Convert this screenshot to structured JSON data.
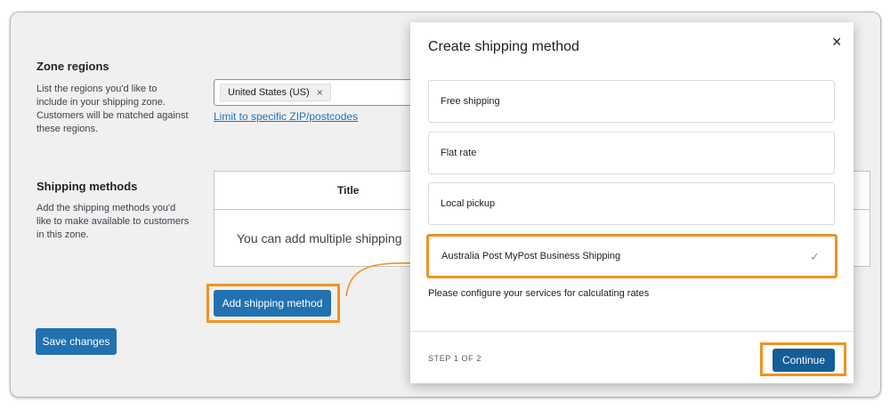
{
  "zone_regions": {
    "title": "Zone regions",
    "description": [
      "List the regions you'd like to",
      "include in your shipping zone.",
      "Customers will be matched against",
      "these regions."
    ],
    "selected_region": "United States (US)",
    "remove_symbol": "×",
    "zip_link": "Limit to specific ZIP/postcodes"
  },
  "shipping_methods": {
    "title": "Shipping methods",
    "description": [
      "Add the shipping methods you'd",
      "like to make available to customers",
      "in this zone."
    ],
    "table_header_title": "Title",
    "empty_text": "You can add multiple shipping",
    "add_button": "Add shipping method"
  },
  "save_button": "Save changes",
  "modal": {
    "title": "Create shipping method",
    "close_symbol": "×",
    "options": [
      {
        "label": "Free shipping"
      },
      {
        "label": "Flat rate"
      },
      {
        "label": "Local pickup"
      },
      {
        "label": "Australia Post MyPost Business Shipping",
        "selected": true
      }
    ],
    "check_symbol": "✓",
    "config_note": "Please configure your services for calculating rates",
    "step_label": "STEP 1 OF 2",
    "continue_button": "Continue"
  },
  "colors": {
    "primary": "#2271b1",
    "continue": "#135e96",
    "highlight": "#f0941e"
  }
}
